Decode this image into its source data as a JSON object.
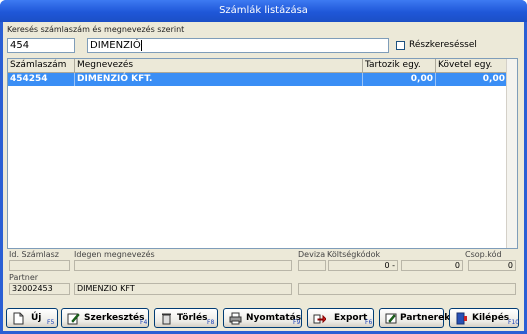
{
  "window": {
    "title": "Számlák listázása"
  },
  "search": {
    "label": "Keresés számlaszám és megnevezés szerint",
    "code_value": "454",
    "name_value": "DIMENZIÓ",
    "partial_label": "Részkereséssel",
    "partial_checked": false
  },
  "grid": {
    "columns": [
      "Számlaszám",
      "Megnevezés",
      "Tartozik egy.",
      "Követel egy."
    ],
    "rows": [
      {
        "szamlaszam": "454254",
        "megnevezes": "DIMENZIÓ KFT.",
        "tartozik": "0,00",
        "kovetel": "0,00"
      }
    ]
  },
  "details": {
    "id_label": "Id. Számlasz",
    "foreign_name_label": "Idegen megnevezés",
    "currency_label": "Deviza",
    "cost_label": "Költségkódok",
    "cost_left_value": "0 -",
    "cost_right_value": "0",
    "group_label": "Csop.kód",
    "group_value": "0",
    "partner_label": "Partner",
    "partner_code": "32002453",
    "partner_name": "DIMENZIO KFT"
  },
  "buttons": {
    "new": {
      "label": "Új",
      "key": "F5"
    },
    "edit": {
      "label": "Szerkesztés",
      "key": "F4"
    },
    "delete": {
      "label": "Törlés",
      "key": "F8"
    },
    "print": {
      "label": "Nyomtatás",
      "key": "F9"
    },
    "export": {
      "label": "Export",
      "key": "F6"
    },
    "partners": {
      "label": "Partnerek",
      "key": ""
    },
    "exit": {
      "label": "Kilépés",
      "key": "F10"
    }
  },
  "colors": {
    "title_bar": "#1f57d8",
    "selection": "#3a8ef5",
    "face": "#ece9d8"
  }
}
